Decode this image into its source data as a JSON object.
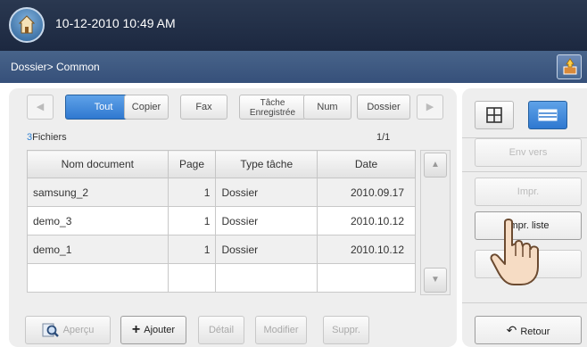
{
  "header": {
    "datetime": "10-12-2010 10:49 AM"
  },
  "breadcrumb": "Dossier> Common",
  "tabs": [
    "Tout",
    "Copier",
    "Fax",
    "Tâche",
    "Enregistrée",
    "Num",
    "Dossier"
  ],
  "file_count": {
    "number": "3",
    "label": "Fichiers"
  },
  "page_indicator": "1/1",
  "table": {
    "headers": [
      "Nom document",
      "Page",
      "Type tâche",
      "Date"
    ],
    "rows": [
      {
        "name": "samsung_2",
        "page": "1",
        "type": "Dossier",
        "date": "2010.09.17"
      },
      {
        "name": "demo_3",
        "page": "1",
        "type": "Dossier",
        "date": "2010.10.12"
      },
      {
        "name": "demo_1",
        "page": "1",
        "type": "Dossier",
        "date": "2010.10.12"
      }
    ]
  },
  "bottom_buttons": {
    "preview": "Aperçu",
    "add": "Ajouter",
    "detail": "Détail",
    "modify": "Modifier",
    "delete": "Suppr."
  },
  "right_buttons": {
    "send": "Env vers",
    "print": "Impr.",
    "print_list": "Impr. liste",
    "partial": "ner",
    "back": "Retour"
  },
  "colors": {
    "accent": "#2f78d0",
    "topbar": "#1c2840",
    "crumbbar": "#3d5881"
  }
}
